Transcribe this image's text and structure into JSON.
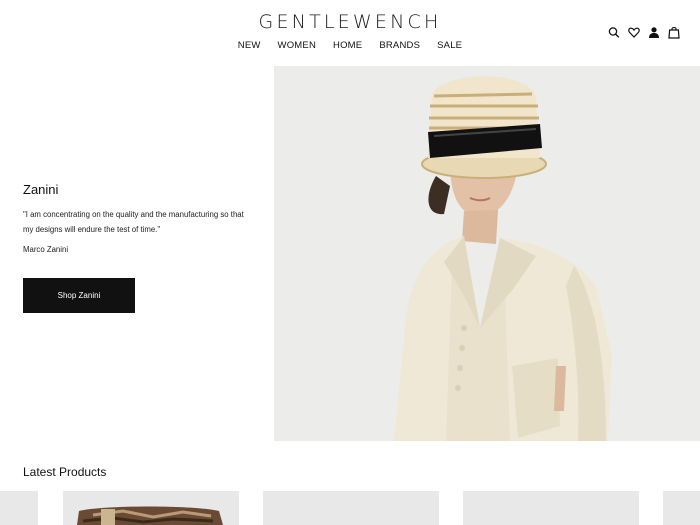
{
  "header": {
    "logo": "GENTLEWENCH",
    "nav": [
      "NEW",
      "WOMEN",
      "HOME",
      "BRANDS",
      "SALE"
    ],
    "icons": [
      "search-icon",
      "heart-icon",
      "account-icon",
      "bag-icon"
    ]
  },
  "hero": {
    "title": "Zanini",
    "quote": "\"I am concentrating on the quality and the manufacturing so that my designs will endure the test of time.\"",
    "author": "Marco Zanini",
    "button": "Shop Zanini"
  },
  "latest": {
    "title": "Latest Products"
  },
  "colors": {
    "button_bg": "#111111",
    "hero_bg": "#ececea",
    "jacket": "#efe8d6",
    "card_bg": "#e8e8e8"
  }
}
